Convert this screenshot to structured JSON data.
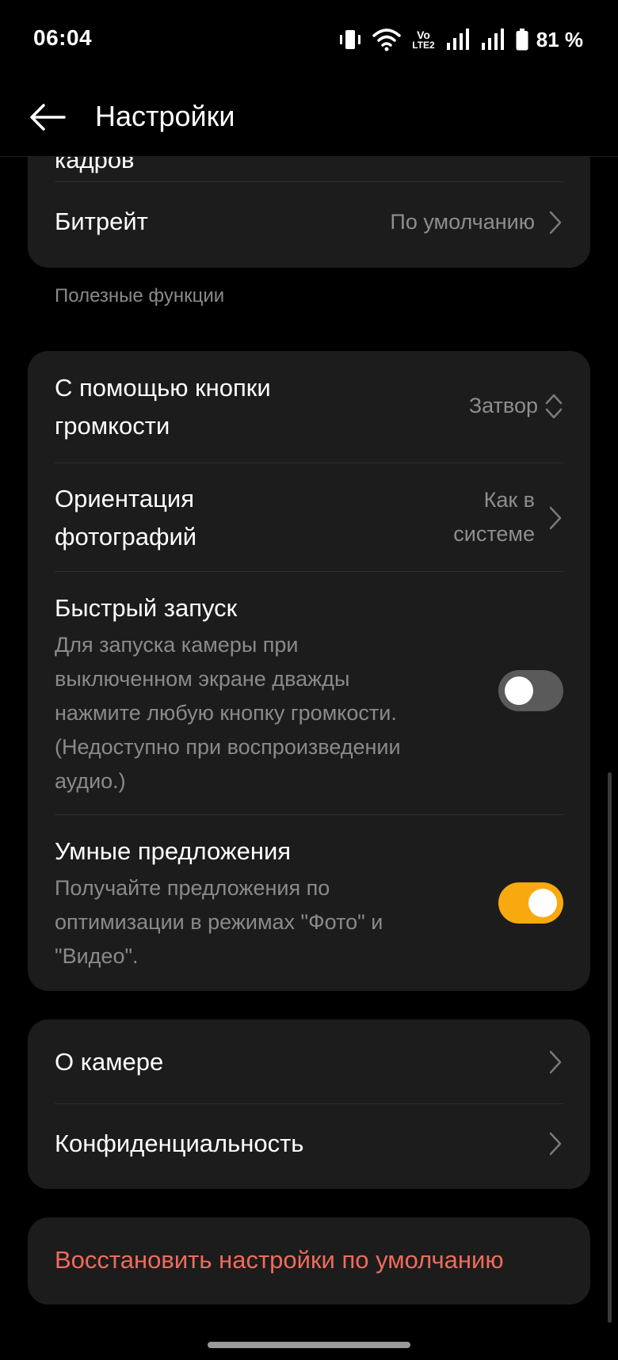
{
  "status_bar": {
    "time": "06:04",
    "network_label_top": "Vo",
    "network_label_bottom": "LTE2",
    "battery_percent": "81 %"
  },
  "app_bar": {
    "title": "Настройки"
  },
  "card_video": {
    "partial_row_label": "кадров",
    "bitrate": {
      "label": "Битрейт",
      "value": "По умолчанию"
    }
  },
  "section_useful": {
    "header": "Полезные функции"
  },
  "card_useful": {
    "volume_button": {
      "label_line1": "С помощью кнопки",
      "label_line2": "громкости",
      "value": "Затвор"
    },
    "photo_orientation": {
      "label_line1": "Ориентация",
      "label_line2": "фотографий",
      "value_line1": "Как в",
      "value_line2": "системе"
    },
    "quick_launch": {
      "label": "Быстрый запуск",
      "desc_lines": [
        "Для запуска камеры при",
        "выключенном экране дважды",
        "нажмите любую кнопку громкости.",
        "(Недоступно при воспроизведении",
        "аудио.)"
      ],
      "enabled": false
    },
    "smart_suggestions": {
      "label": "Умные предложения",
      "desc_lines": [
        "Получайте предложения по",
        "оптимизации в режимах \"Фото\" и",
        "\"Видео\"."
      ],
      "enabled": true
    }
  },
  "card_about": {
    "about_camera": {
      "label": "О камере"
    },
    "privacy": {
      "label": "Конфиденциальность"
    }
  },
  "reset": {
    "label": "Восстановить настройки по умолчанию"
  },
  "colors": {
    "accent_toggle": "#f8a90f",
    "reset_text": "#ef6b5b",
    "card_bg": "#1c1c1c"
  }
}
